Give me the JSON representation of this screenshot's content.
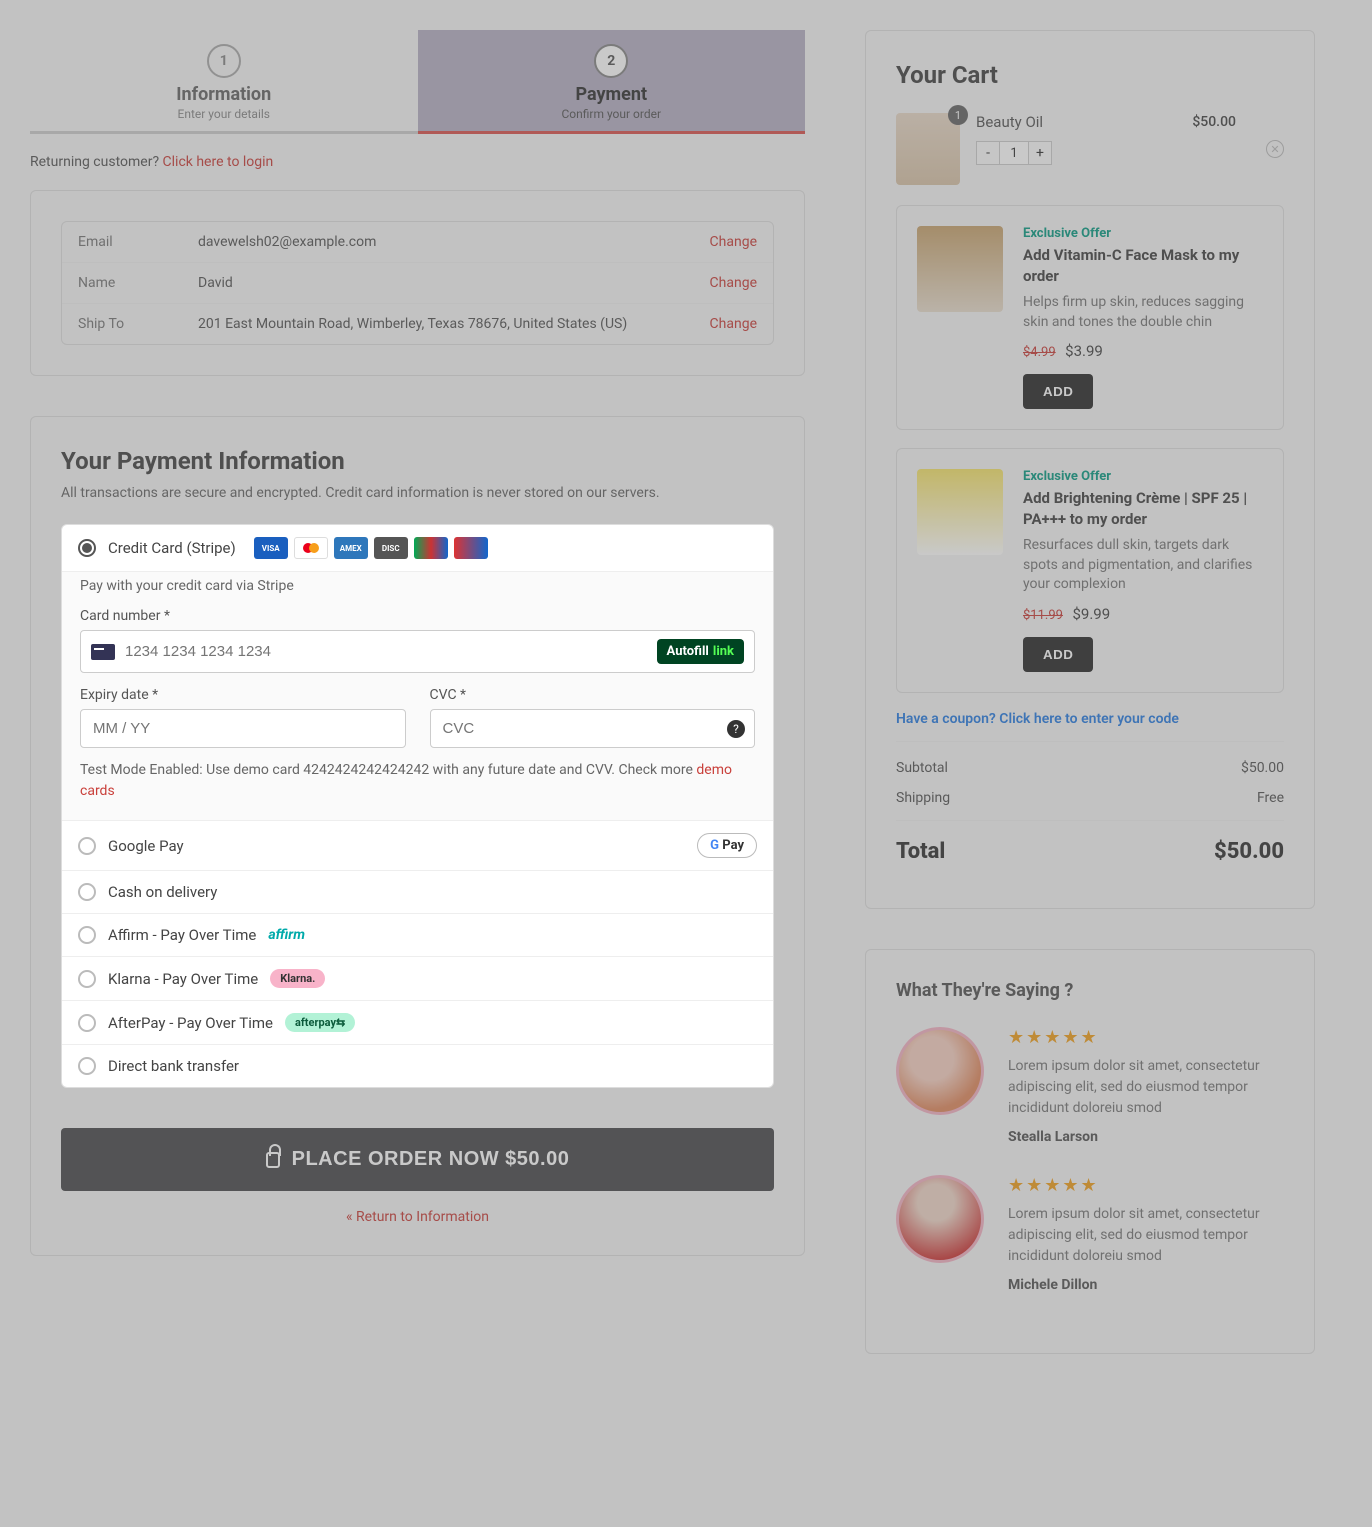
{
  "steps": {
    "s1_num": "1",
    "s1_title": "Information",
    "s1_sub": "Enter your details",
    "s2_num": "2",
    "s2_title": "Payment",
    "s2_sub": "Confirm your order"
  },
  "returning": {
    "text": "Returning customer? ",
    "link": "Click here to login"
  },
  "info": {
    "email_label": "Email",
    "email_value": "davewelsh02@example.com",
    "name_label": "Name",
    "name_value": "David",
    "ship_label": "Ship To",
    "ship_value": "201 East Mountain Road, Wimberley, Texas 78676, United States (US)",
    "change": "Change"
  },
  "payment": {
    "heading": "Your Payment Information",
    "subheading": "All transactions are secure and encrypted. Credit card information is never stored on our servers.",
    "stripe_label": "Credit Card (Stripe)",
    "stripe_hint": "Pay with your credit card via Stripe",
    "card_label": "Card number *",
    "card_placeholder": "1234 1234 1234 1234",
    "autofill": "Autofill",
    "autofill_link": "link",
    "expiry_label": "Expiry date *",
    "expiry_placeholder": "MM / YY",
    "cvc_label": "CVC *",
    "cvc_placeholder": "CVC",
    "testmode_a": "Test Mode Enabled: Use demo card 4242424242424242 with any future date and CVV. Check more ",
    "testmode_link": "demo cards",
    "gpay": "Google Pay",
    "cod": "Cash on delivery",
    "affirm": "Affirm - Pay Over Time",
    "klarna": "Klarna - Pay Over Time",
    "klarna_badge": "Klarna.",
    "afterpay": "AfterPay - Pay Over Time",
    "afterpay_badge": "afterpay⇆",
    "bank": "Direct bank transfer"
  },
  "actions": {
    "place_order": "PLACE ORDER NOW  $50.00",
    "return": "« Return to Information"
  },
  "cart": {
    "title": "Your Cart",
    "item_name": "Beauty Oil",
    "item_price": "$50.00",
    "item_qty_badge": "1",
    "item_qty": "1",
    "offer_tag": "Exclusive Offer",
    "offer1_title": "Add Vitamin-C Face Mask to my order",
    "offer1_desc": "Helps firm up skin, reduces sagging skin and tones the double chin",
    "offer1_old": "$4.99",
    "offer1_new": "$3.99",
    "offer2_title": "Add Brightening Crème | SPF 25 | PA+++ to my order",
    "offer2_desc": "Resurfaces dull skin, targets dark spots and pigmentation, and clarifies your complexion",
    "offer2_old": "$11.99",
    "offer2_new": "$9.99",
    "add": "ADD",
    "coupon": "Have a coupon? Click here to enter your code",
    "subtotal_l": "Subtotal",
    "subtotal_v": "$50.00",
    "shipping_l": "Shipping",
    "shipping_v": "Free",
    "total_l": "Total",
    "total_v": "$50.00"
  },
  "testimonials": {
    "heading": "What They're Saying ?",
    "text": "Lorem ipsum dolor sit amet, consectetur adipiscing elit, sed do eiusmod tempor incididunt doloreiu smod",
    "name1": "Stealla Larson",
    "name2": "Michele Dillon",
    "stars": "★★★★★"
  }
}
